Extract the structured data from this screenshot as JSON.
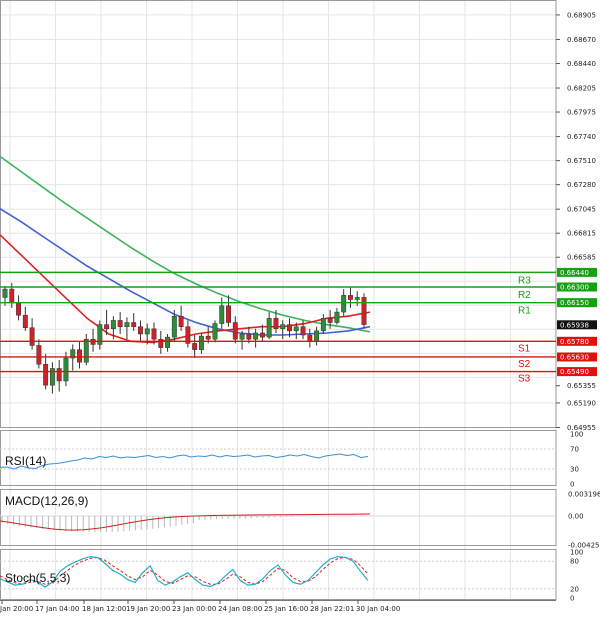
{
  "chart_data": {
    "type": "candlestick",
    "colors": {
      "up": "#2e8b3a",
      "down": "#d0202a",
      "grid": "#e6e6e6",
      "resistance": "#16a016",
      "support": "#e01010",
      "ma_fast": "#e02020",
      "ma_mid": "#4060d0",
      "ma_slow": "#3cb45a",
      "rsi": "#3b8fd8",
      "macd": "#d02020",
      "stoch_main": "#20b0c8",
      "stoch_signal": "#e02020"
    },
    "price_axis": {
      "ylim": [
        0.6495,
        0.69
      ],
      "ticks": [
        "0.68905",
        "0.68670",
        "0.68440",
        "0.68205",
        "0.67975",
        "0.67740",
        "0.67510",
        "0.67280",
        "0.67045",
        "0.66815",
        "0.66585",
        "0.65355",
        "0.65190",
        "0.64955"
      ]
    },
    "levels": [
      {
        "name": "R3",
        "value": 0.6644,
        "label": "0.66440",
        "kind": "resistance"
      },
      {
        "name": "R2",
        "value": 0.663,
        "label": "0.66300",
        "kind": "resistance"
      },
      {
        "name": "R1",
        "value": 0.6615,
        "label": "0.66150",
        "kind": "resistance"
      },
      {
        "name": "S1",
        "value": 0.6578,
        "label": "0.65780",
        "kind": "support"
      },
      {
        "name": "S2",
        "value": 0.6563,
        "label": "0.65630",
        "kind": "support"
      },
      {
        "name": "S3",
        "value": 0.6549,
        "label": "0.65490",
        "kind": "support"
      }
    ],
    "current_price": {
      "value": 0.65938,
      "label": "0.65938"
    },
    "x_labels": [
      "Jan 20:00",
      "17 Jan 04:00",
      "18 Jan 12:00",
      "19 Jan 20:00",
      "23 Jan 00:00",
      "24 Jan 08:00",
      "25 Jan 16:00",
      "28 Jan 22:01",
      "30 Jan 04:00"
    ],
    "candles": [
      [
        0.662,
        0.6631,
        0.6612,
        0.6628
      ],
      [
        0.6628,
        0.6634,
        0.661,
        0.6615
      ],
      [
        0.6615,
        0.6622,
        0.6598,
        0.6603
      ],
      [
        0.6603,
        0.6611,
        0.6588,
        0.6591
      ],
      [
        0.6591,
        0.66,
        0.657,
        0.6574
      ],
      [
        0.6574,
        0.658,
        0.6552,
        0.6556
      ],
      [
        0.6556,
        0.6566,
        0.6532,
        0.6536
      ],
      [
        0.6536,
        0.6558,
        0.6528,
        0.6552
      ],
      [
        0.6552,
        0.656,
        0.653,
        0.654
      ],
      [
        0.654,
        0.6568,
        0.6535,
        0.6562
      ],
      [
        0.6562,
        0.6575,
        0.655,
        0.657
      ],
      [
        0.657,
        0.6578,
        0.6552,
        0.6558
      ],
      [
        0.6558,
        0.6585,
        0.6555,
        0.658
      ],
      [
        0.658,
        0.659,
        0.6568,
        0.6575
      ],
      [
        0.6575,
        0.6598,
        0.657,
        0.6594
      ],
      [
        0.6594,
        0.6608,
        0.6584,
        0.659
      ],
      [
        0.659,
        0.6602,
        0.658,
        0.6598
      ],
      [
        0.6598,
        0.6606,
        0.6585,
        0.6592
      ],
      [
        0.6592,
        0.6601,
        0.658,
        0.6596
      ],
      [
        0.6596,
        0.6605,
        0.6588,
        0.6592
      ],
      [
        0.6592,
        0.6598,
        0.6578,
        0.6585
      ],
      [
        0.6585,
        0.6595,
        0.6575,
        0.659
      ],
      [
        0.659,
        0.6596,
        0.6575,
        0.658
      ],
      [
        0.658,
        0.6588,
        0.6566,
        0.6572
      ],
      [
        0.6572,
        0.6585,
        0.6568,
        0.6582
      ],
      [
        0.6582,
        0.6608,
        0.6578,
        0.6602
      ],
      [
        0.6602,
        0.6612,
        0.6588,
        0.6592
      ],
      [
        0.6592,
        0.6598,
        0.6572,
        0.6576
      ],
      [
        0.6576,
        0.6584,
        0.6562,
        0.657
      ],
      [
        0.657,
        0.6586,
        0.6566,
        0.6583
      ],
      [
        0.6583,
        0.6592,
        0.6576,
        0.658
      ],
      [
        0.658,
        0.6598,
        0.6577,
        0.6595
      ],
      [
        0.6595,
        0.662,
        0.659,
        0.6612
      ],
      [
        0.6612,
        0.6622,
        0.6592,
        0.6596
      ],
      [
        0.6596,
        0.6602,
        0.6576,
        0.658
      ],
      [
        0.658,
        0.6588,
        0.657,
        0.6585
      ],
      [
        0.6585,
        0.6592,
        0.6576,
        0.658
      ],
      [
        0.658,
        0.659,
        0.6572,
        0.6586
      ],
      [
        0.6586,
        0.6594,
        0.6578,
        0.6582
      ],
      [
        0.6582,
        0.6606,
        0.658,
        0.66
      ],
      [
        0.66,
        0.6608,
        0.6586,
        0.659
      ],
      [
        0.659,
        0.6598,
        0.658,
        0.6594
      ],
      [
        0.6594,
        0.66,
        0.6582,
        0.6588
      ],
      [
        0.6588,
        0.6596,
        0.658,
        0.6592
      ],
      [
        0.6592,
        0.6598,
        0.658,
        0.6584
      ],
      [
        0.6584,
        0.659,
        0.6572,
        0.6578
      ],
      [
        0.6578,
        0.6592,
        0.6574,
        0.6588
      ],
      [
        0.6588,
        0.6604,
        0.6585,
        0.66
      ],
      [
        0.66,
        0.6608,
        0.659,
        0.6596
      ],
      [
        0.6596,
        0.661,
        0.6594,
        0.6606
      ],
      [
        0.6606,
        0.6628,
        0.6602,
        0.6622
      ],
      [
        0.6622,
        0.663,
        0.661,
        0.6618
      ],
      [
        0.6618,
        0.6626,
        0.6612,
        0.662
      ],
      [
        0.662,
        0.6624,
        0.659,
        0.6594
      ]
    ],
    "ma_fast": [
      0.668,
      0.666,
      0.664,
      0.662,
      0.66,
      0.6585,
      0.6578,
      0.6577,
      0.658,
      0.6585,
      0.6588,
      0.659,
      0.6592,
      0.6592,
      0.6595,
      0.66,
      0.6602,
      0.6606
    ],
    "ma_mid": [
      0.6705,
      0.6692,
      0.6678,
      0.6664,
      0.665,
      0.6638,
      0.6626,
      0.6615,
      0.6604,
      0.6596,
      0.659,
      0.6586,
      0.6584,
      0.6584,
      0.6585,
      0.6586,
      0.6588,
      0.6592
    ],
    "ma_slow": [
      0.6755,
      0.674,
      0.6725,
      0.671,
      0.6696,
      0.6682,
      0.6668,
      0.6655,
      0.6643,
      0.6633,
      0.6624,
      0.6616,
      0.6609,
      0.6603,
      0.6598,
      0.6594,
      0.6591,
      0.6587
    ],
    "rsi": {
      "label": "RSI(14)",
      "ticks": [
        "100",
        "70",
        "30",
        "0"
      ],
      "values": [
        33,
        34,
        30,
        36,
        32,
        31,
        37,
        40,
        41,
        43,
        46,
        48,
        52,
        50,
        55,
        53,
        56,
        52,
        54,
        53,
        55,
        57,
        53,
        55,
        52,
        56,
        58,
        54,
        56,
        55,
        58,
        54,
        57,
        55,
        56,
        58,
        54,
        56,
        57,
        53,
        55,
        58,
        56,
        59,
        55,
        52,
        56,
        58,
        60,
        57,
        59,
        53,
        55
      ]
    },
    "macd": {
      "label": "MACD(12,26,9)",
      "ticks": [
        "0.003196",
        "0.00",
        "-0.004255"
      ]
    },
    "stoch": {
      "label": "Stoch(5,5,3)",
      "ticks": [
        "100",
        "80",
        "20",
        "0"
      ],
      "main": [
        42,
        35,
        28,
        30,
        40,
        35,
        24,
        35,
        58,
        70,
        78,
        85,
        90,
        88,
        75,
        60,
        52,
        40,
        34,
        55,
        70,
        38,
        28,
        35,
        46,
        55,
        40,
        28,
        25,
        32,
        48,
        62,
        38,
        28,
        30,
        42,
        60,
        72,
        50,
        34,
        30,
        38,
        55,
        72,
        85,
        90,
        88,
        80,
        58,
        38
      ],
      "signal": [
        48,
        40,
        33,
        30,
        34,
        36,
        30,
        32,
        48,
        60,
        72,
        80,
        86,
        88,
        82,
        70,
        60,
        48,
        40,
        46,
        60,
        50,
        36,
        32,
        40,
        48,
        46,
        36,
        30,
        30,
        40,
        52,
        46,
        34,
        30,
        36,
        50,
        64,
        60,
        44,
        36,
        36,
        46,
        62,
        76,
        86,
        88,
        84,
        70,
        52
      ]
    }
  }
}
